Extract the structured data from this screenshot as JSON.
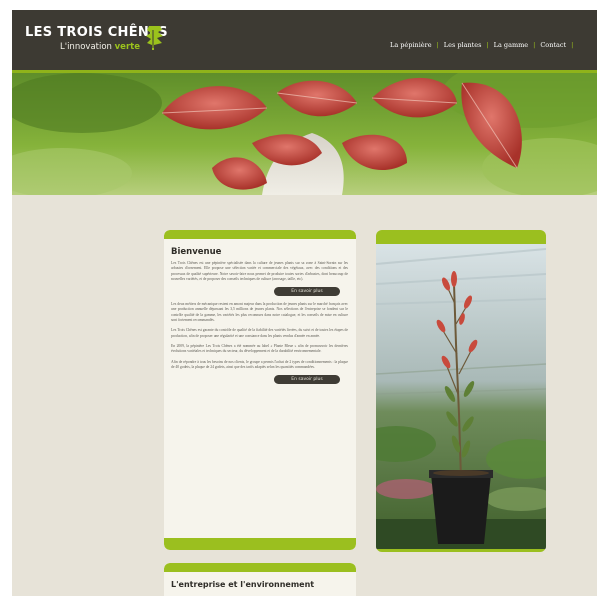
{
  "brand": {
    "name": "LES TROIS CHÊNES",
    "tagline_prefix": "L'innovation",
    "tagline_accent": "verte"
  },
  "nav": {
    "items": [
      {
        "label": "La pépinière"
      },
      {
        "label": "Les plantes"
      },
      {
        "label": "La gamme"
      },
      {
        "label": "Contact"
      }
    ]
  },
  "welcome": {
    "title": "Bienvenue",
    "paragraphs": [
      "Les Trois Chênes est une pépinière spécialisée dans la culture de jeunes plants sur sa zone à Saint-Sornin sur les arbustes d'ornement. Elle propose une sélection variée et commerciale des végétaux, avec des conditions et des processus de qualité supérieure. Notre savoir-faire nous permet de produire toutes sortes d'arbustes, dont beaucoup de nouvelles variétés, et de proposer des conseils techniques de culture (arrosage, taille, etc).",
      "Les deux métiers de mécanique restent en amont majeur dans la production de jeunes plants sur le marché français avec une production annuelle dépassant les 3,5 millions de jeunes plants. Nos sélections de l'entreprise se fondent sur le contrôle qualité de la gamme, les variétés les plus reconnues dans notre catalogue, et les conseils de mise en culture sont fortement recommandés.",
      "Les Trois Chênes est garante du contrôle de qualité de la fiabilité des variétés livrées, du suivi et de toutes les étapes de production, afin de proposer une régularité et une constance dans les plants vendus d'année en année.",
      "En 2009, la pépinière Les Trois Chênes a été nommée au label « Plante Bleue » afin de promouvoir les dernières évolutions variétales et techniques du secteur, du développement et de la durabilité environnementale.",
      "Afin de répondre à tous les besoins de nos clients, le groupe a permis l'achat de 2 types de conditionnements : la plaque de 40 godets, la plaque de 24 godets, ainsi que des tarifs adaptés selon les quantités commandées."
    ],
    "button_more_1": "En savoir plus",
    "button_more_2": "En savoir plus"
  },
  "section2": {
    "title": "L'entreprise et l'environnement"
  },
  "colors": {
    "header_bg": "#3d3a33",
    "accent_green": "#9bbf1f",
    "page_bg": "#e7e3d8",
    "card_bg": "#f6f4ec"
  },
  "icons": {
    "logo": "oak-tree-leaf-icon"
  }
}
